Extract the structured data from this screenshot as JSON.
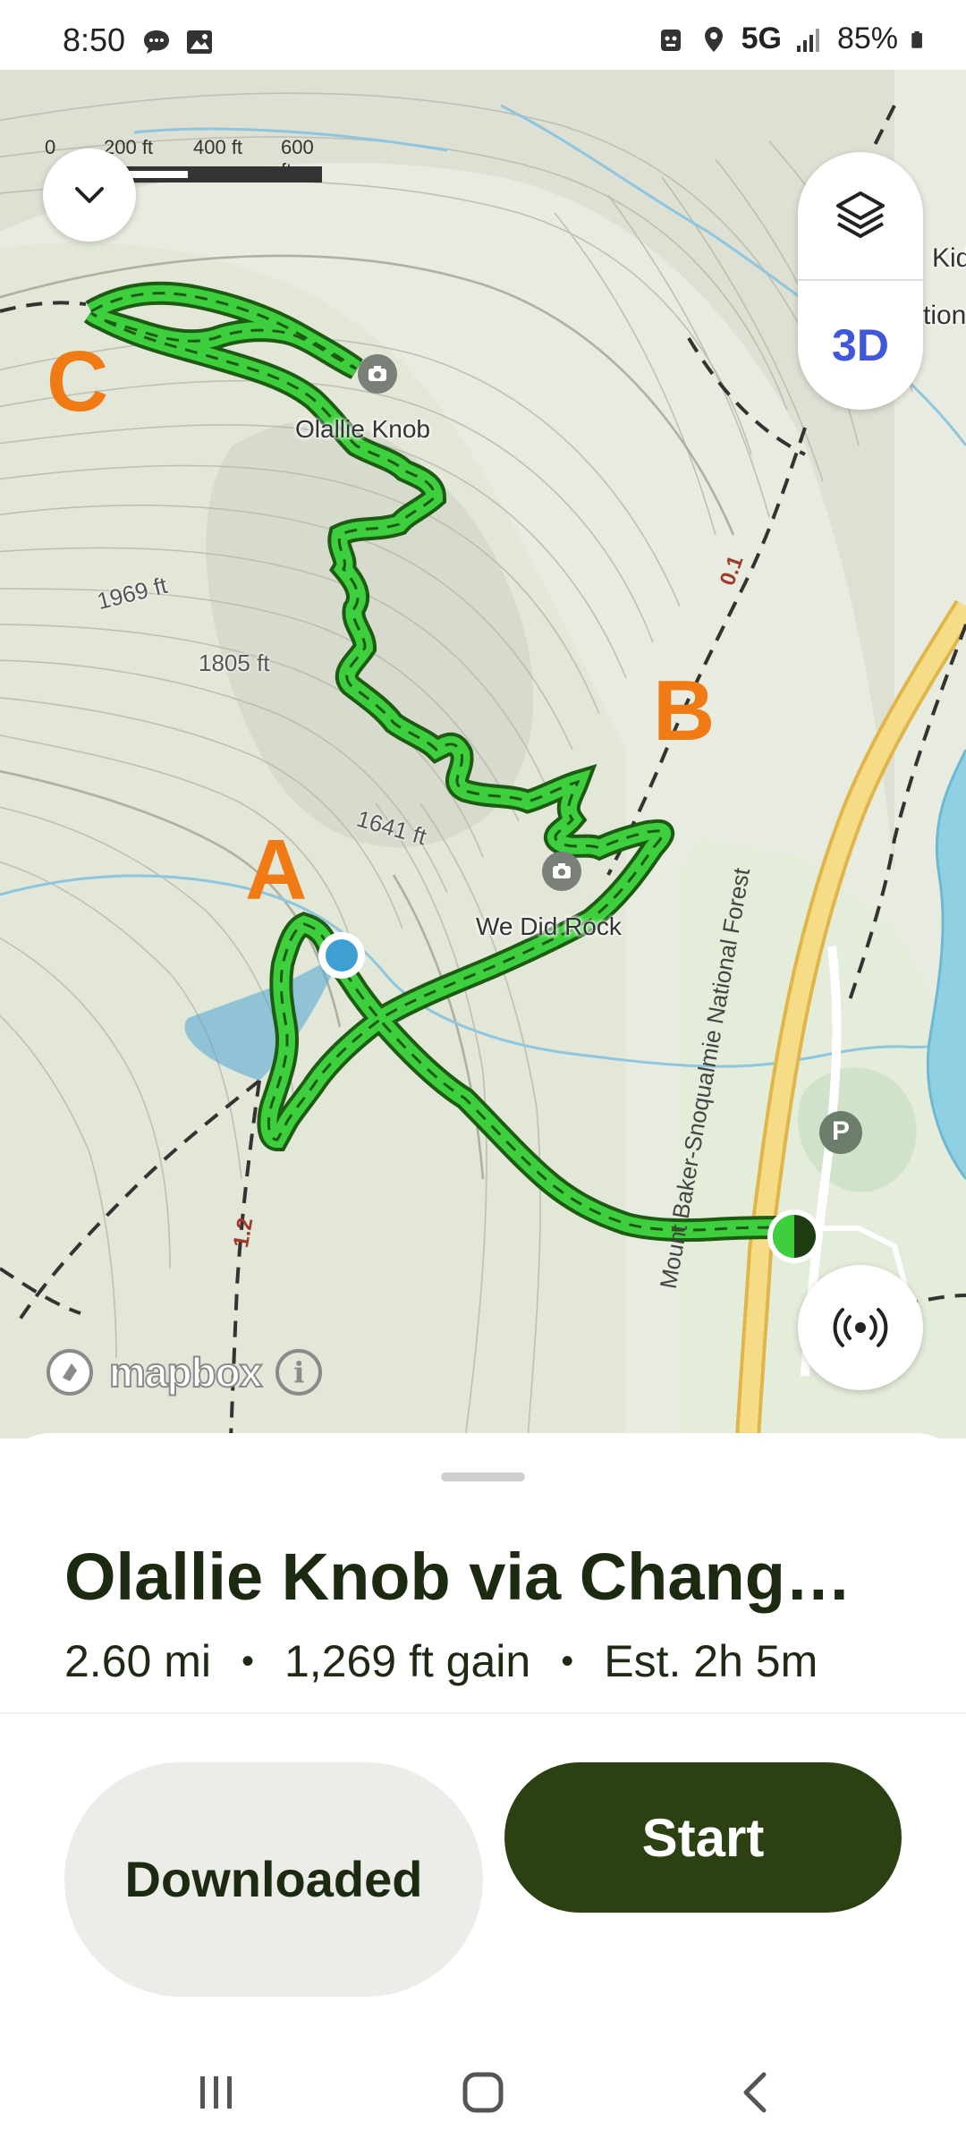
{
  "status_bar": {
    "time": "8:50",
    "network": "5G",
    "battery": "85%",
    "icons_left": [
      "chat-bubble-icon",
      "image-icon"
    ],
    "icons_right": [
      "robot-icon",
      "location-icon",
      "signal-icon",
      "battery-icon"
    ]
  },
  "map": {
    "scale": {
      "ticks": [
        "0",
        "200 ft",
        "400 ft",
        "600 ft"
      ]
    },
    "layers_icon": "layers-icon",
    "mode_3d_label": "3D",
    "waypoints": [
      "A",
      "B",
      "C"
    ],
    "poi_labels": [
      "Olallie Knob",
      "We Did Rock"
    ],
    "elevation_labels": [
      "1969 ft",
      "1805 ft",
      "1641 ft"
    ],
    "trail_numbers": [
      "0.1",
      "1.2"
    ],
    "forest_label": "Mount Baker-Snoqualmie National Forest",
    "parking_label": "P",
    "partial_label_1": "Kid",
    "partial_label_2": "tion",
    "attribution": "mapbox",
    "info_label": "i",
    "colors": {
      "trail": "#3ecf3e",
      "trail_border": "#1d5a12",
      "waypoint": "#f07b14",
      "accent": "#3f57d8"
    }
  },
  "sheet": {
    "title": "Olallie Knob via Chang…",
    "distance": "2.60 mi",
    "gain": "1,269 ft gain",
    "estimate": "Est. 2h 5m",
    "separator": "•",
    "downloaded_label": "Downloaded",
    "start_label": "Start",
    "colors": {
      "start_bg": "#2b4112",
      "downloaded_bg": "#ecede8"
    }
  },
  "nav": {
    "items": [
      "recent-apps",
      "home",
      "back"
    ]
  }
}
